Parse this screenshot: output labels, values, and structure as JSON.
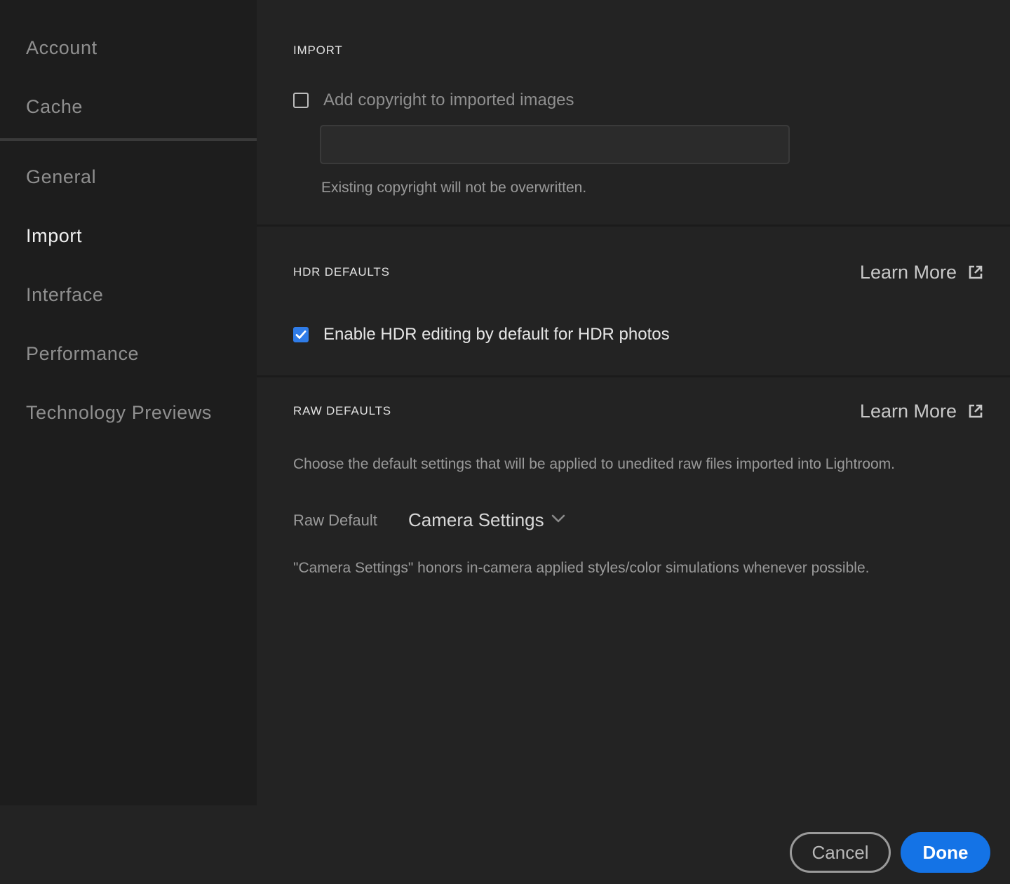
{
  "sidebar": {
    "items": [
      {
        "label": "Account",
        "active": false
      },
      {
        "label": "Cache",
        "active": false
      },
      {
        "label": "General",
        "active": false
      },
      {
        "label": "Import",
        "active": true
      },
      {
        "label": "Interface",
        "active": false
      },
      {
        "label": "Performance",
        "active": false
      },
      {
        "label": "Technology Previews",
        "active": false
      }
    ]
  },
  "import": {
    "title": "IMPORT",
    "copyright_checkbox_label": "Add copyright to imported images",
    "copyright_checked": false,
    "copyright_value": "",
    "hint": "Existing copyright will not be overwritten."
  },
  "hdr": {
    "title": "HDR DEFAULTS",
    "learn_more": "Learn More",
    "checkbox_label": "Enable HDR editing by default for HDR photos",
    "checked": true
  },
  "raw": {
    "title": "RAW DEFAULTS",
    "learn_more": "Learn More",
    "description": "Choose the default settings that will be applied to unedited raw files imported into Lightroom.",
    "raw_default_label": "Raw Default",
    "raw_default_value": "Camera Settings",
    "note": "\"Camera Settings\" honors in-camera applied styles/color simulations whenever possible."
  },
  "footer": {
    "cancel": "Cancel",
    "done": "Done"
  },
  "colors": {
    "accent": "#1473e6",
    "checkbox_checked": "#2f7ce8",
    "background": "#232323",
    "sidebar": "#1d1d1d"
  }
}
